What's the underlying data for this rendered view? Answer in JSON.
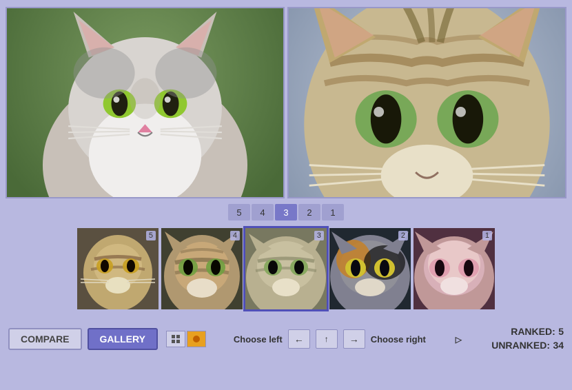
{
  "preview": {
    "left_cat": "fluffy gray-white cat sitting on ledge with green background",
    "right_cat": "tabby cat close-up portrait"
  },
  "rank_buttons": [
    {
      "label": "5",
      "active": false
    },
    {
      "label": "4",
      "active": false
    },
    {
      "label": "3",
      "active": true
    },
    {
      "label": "2",
      "active": false
    },
    {
      "label": "1",
      "active": false
    }
  ],
  "thumbnails": [
    {
      "rank": "5",
      "selected": false,
      "gradient": "thumb-cat-1"
    },
    {
      "rank": "4",
      "selected": false,
      "gradient": "thumb-cat-2"
    },
    {
      "rank": "3",
      "selected": true,
      "gradient": "thumb-cat-3"
    },
    {
      "rank": "2",
      "selected": false,
      "gradient": "thumb-cat-4"
    },
    {
      "rank": "1",
      "selected": false,
      "gradient": "thumb-cat-5"
    }
  ],
  "controls": {
    "compare_label": "COMPARE",
    "gallery_label": "GALLERY",
    "choose_left_label": "Choose left",
    "choose_right_label": "Choose right",
    "left_arrow": "←",
    "right_arrow": "→",
    "up_arrow": "↑"
  },
  "stats": {
    "ranked_label": "RANKED:",
    "ranked_value": "5",
    "unranked_label": "UNRANKED:",
    "unranked_value": "34"
  }
}
